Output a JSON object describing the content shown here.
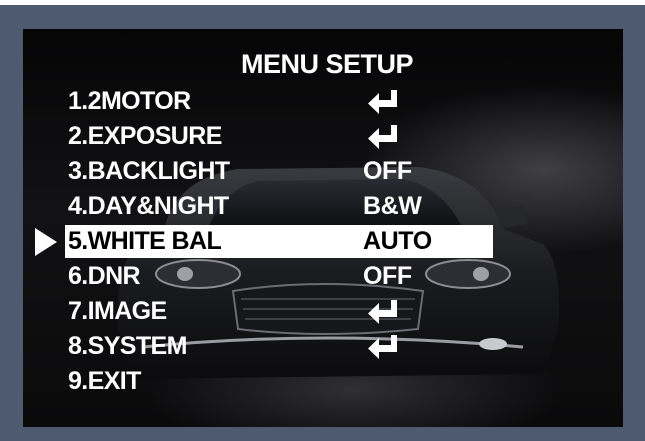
{
  "menu": {
    "title": "MENU SETUP",
    "items": [
      {
        "label": "1.2MOTOR",
        "value": "",
        "icon": "enter-arrow-icon",
        "selected": false
      },
      {
        "label": "2.EXPOSURE",
        "value": "",
        "icon": "enter-arrow-icon",
        "selected": false
      },
      {
        "label": "3.BACKLIGHT",
        "value": "OFF",
        "icon": "",
        "selected": false
      },
      {
        "label": "4.DAY&NIGHT",
        "value": "B&W",
        "icon": "",
        "selected": false
      },
      {
        "label": "5.WHITE BAL",
        "value": "AUTO",
        "icon": "",
        "selected": true
      },
      {
        "label": "6.DNR",
        "value": "OFF",
        "icon": "",
        "selected": false
      },
      {
        "label": "7.IMAGE",
        "value": "",
        "icon": "enter-arrow-icon",
        "selected": false
      },
      {
        "label": "8.SYSTEM",
        "value": "",
        "icon": "enter-arrow-icon",
        "selected": false
      },
      {
        "label": "9.EXIT",
        "value": "",
        "icon": "",
        "selected": false
      }
    ]
  },
  "colors": {
    "frame": "#4d5a6f",
    "text": "#ffffff",
    "highlight_bg": "#ffffff",
    "highlight_text": "#000000",
    "pointer": "#ffffff"
  }
}
